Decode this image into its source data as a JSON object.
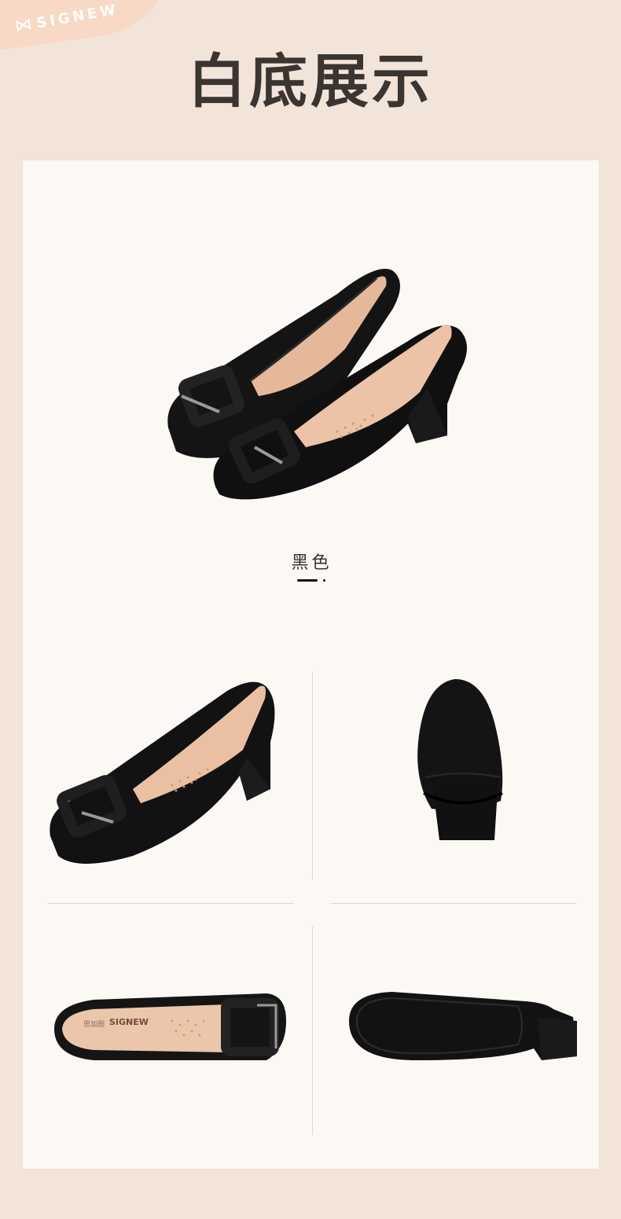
{
  "header": {
    "brand": "SIGNEW",
    "brand_icon": "bow-icon",
    "title": "白底展示"
  },
  "product": {
    "color_label": "黑色"
  },
  "colors": {
    "background": "#f3e4da",
    "panel": "#fcf9f5",
    "title_text": "#3b3532",
    "shoe_black": "#151515",
    "insole": "#e8b99a"
  },
  "insole_print": {
    "brand_cn": "思加图",
    "brand_en": "SIGNEW"
  }
}
